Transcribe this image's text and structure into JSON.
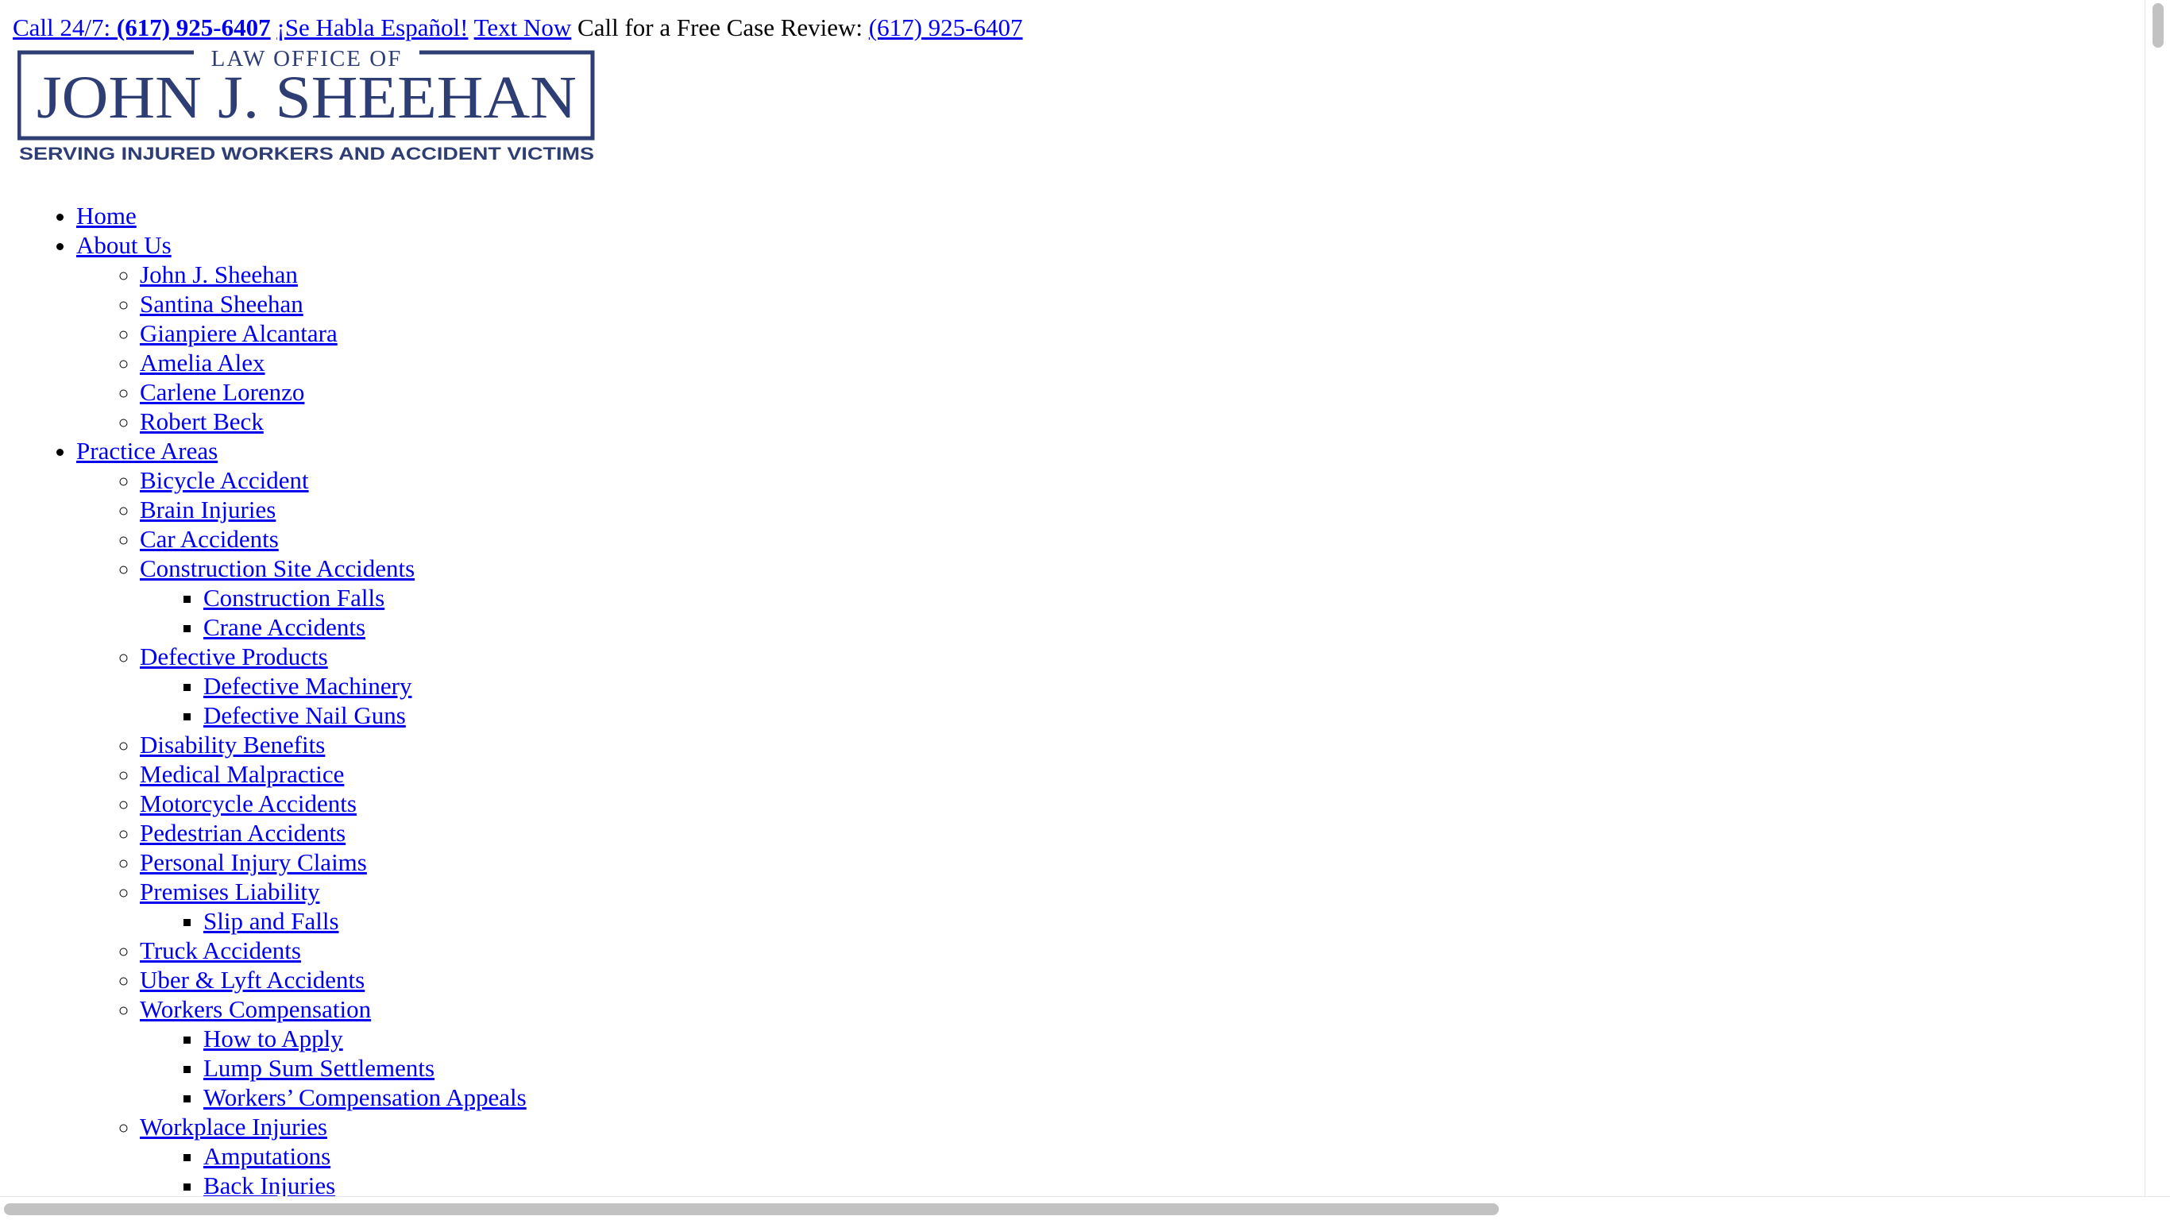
{
  "topbar": {
    "call_prefix": "Call 24/7: ",
    "call_number": "(617) 925-6407",
    "spanish": "¡Se Habla Español!",
    "text_now": "Text Now",
    "free_review_label": " Call for a Free Case Review: ",
    "free_review_number": "(617) 925-6407"
  },
  "logo": {
    "line1": "LAW OFFICE OF",
    "line2": "JOHN J. SHEEHAN",
    "line3": "SERVING INJURED WORKERS AND ACCIDENT VICTIMS",
    "color": "#2e3d73"
  },
  "nav": {
    "home": "Home",
    "about": "About Us",
    "about_items": [
      "John J. Sheehan",
      "Santina Sheehan",
      "Gianpiere Alcantara",
      "Amelia Alex",
      "Carlene Lorenzo",
      "Robert Beck"
    ],
    "practice": "Practice Areas",
    "practice_items": {
      "bicycle": "Bicycle Accident",
      "brain": "Brain Injuries",
      "car": "Car Accidents",
      "construction": "Construction Site Accidents",
      "construction_sub": [
        "Construction Falls",
        "Crane Accidents"
      ],
      "defective": "Defective Products",
      "defective_sub": [
        "Defective Machinery",
        "Defective Nail Guns"
      ],
      "disability": "Disability Benefits",
      "medical": "Medical Malpractice",
      "motorcycle": "Motorcycle Accidents",
      "pedestrian": "Pedestrian Accidents",
      "personal": "Personal Injury Claims",
      "premises": "Premises Liability",
      "premises_sub": [
        "Slip and Falls"
      ],
      "truck": "Truck Accidents",
      "uber": "Uber & Lyft Accidents",
      "workers": "Workers Compensation",
      "workers_sub": [
        "How to Apply",
        "Lump Sum Settlements",
        "Workers’ Compensation Appeals"
      ],
      "workplace": "Workplace Injuries",
      "workplace_sub": [
        "Amputations",
        "Back Injuries"
      ]
    }
  },
  "colors": {
    "link": "#0000ee",
    "scrollbar_thumb": "#c2c2c2"
  }
}
